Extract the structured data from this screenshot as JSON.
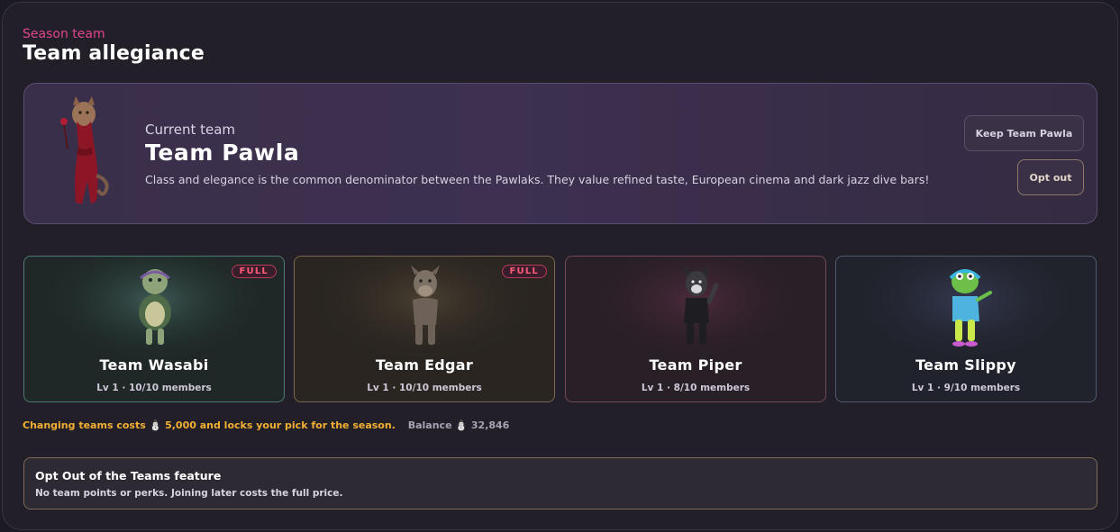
{
  "header": {
    "eyebrow": "Season team",
    "title": "Team allegiance"
  },
  "current_team": {
    "label": "Current team",
    "name": "Team Pawla",
    "description": "Class and elegance is the common denominator between the Pawlaks. They value refined taste, European cinema and dark jazz dive bars!",
    "avatar_icon": "pawla-cat-avatar",
    "keep_button": "Keep Team Pawla",
    "optout_button": "Opt out"
  },
  "teams": [
    {
      "name": "Team Wasabi",
      "meta": "Lv 1 · 10/10 members",
      "badge": "FULL",
      "avatar_icon": "turtle-avatar",
      "accent": "#4d7a72"
    },
    {
      "name": "Team Edgar",
      "meta": "Lv 1 · 10/10 members",
      "badge": "FULL",
      "avatar_icon": "donkey-avatar",
      "accent": "#7a6950"
    },
    {
      "name": "Team Piper",
      "meta": "Lv 1 · 8/10 members",
      "badge": "",
      "avatar_icon": "wolf-avatar",
      "accent": "#74485a"
    },
    {
      "name": "Team Slippy",
      "meta": "Lv 1 · 9/10 members",
      "badge": "",
      "avatar_icon": "frog-avatar",
      "accent": "#4f5a70"
    }
  ],
  "cost_notice": {
    "text": "Changing teams costs ⛄ 5,000 and locks your pick for the season.",
    "balance": "Balance ⛄ 32,846"
  },
  "optout_feature": {
    "title": "Opt Out of the Teams feature",
    "description": "No team points or perks. Joining later costs the full price."
  },
  "colors": {
    "accent_pink": "#e0468d",
    "warning_gold": "#f2b033",
    "full_badge": "#ff5a7a"
  }
}
